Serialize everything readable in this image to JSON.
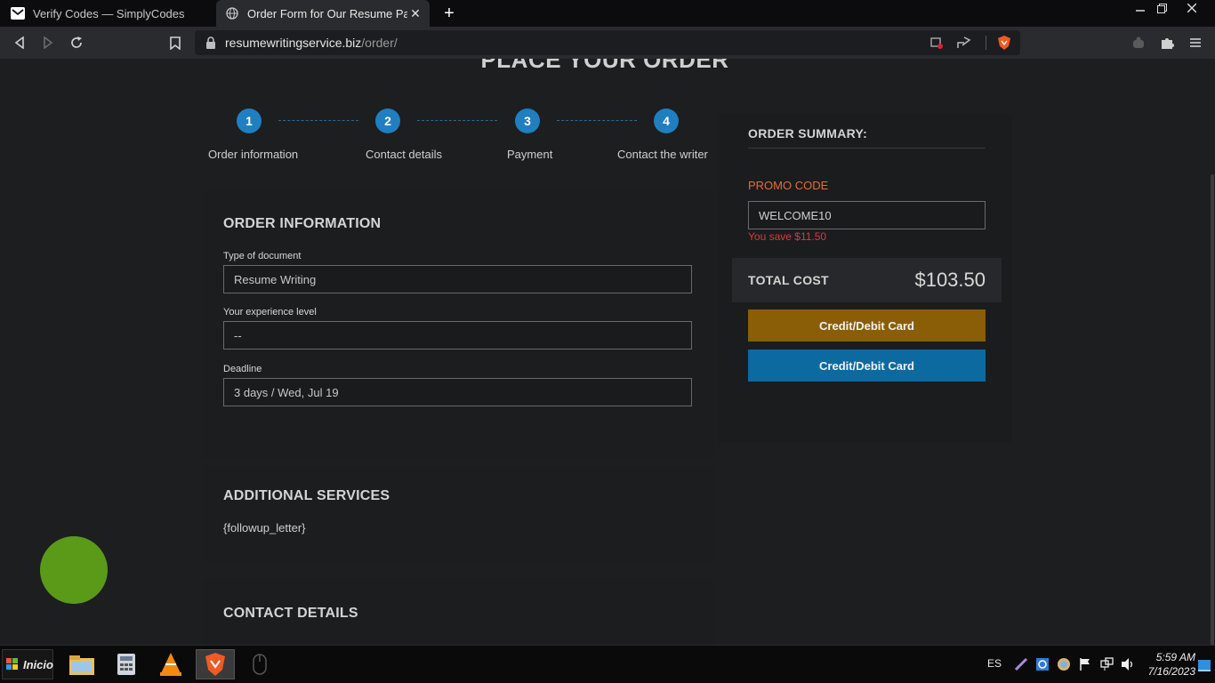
{
  "browser": {
    "tabs": [
      {
        "title": "Verify Codes — SimplyCodes",
        "favicon": "mail-icon"
      },
      {
        "title": "Order Form for Our Resume Packa",
        "favicon": "globe-icon"
      }
    ],
    "new_tab": "+",
    "url_domain": "resumewritingservice.biz",
    "url_path": "/order/"
  },
  "page": {
    "title": "PLACE YOUR ORDER",
    "steps": [
      {
        "number": "1",
        "label": "Order information"
      },
      {
        "number": "2",
        "label": "Contact details"
      },
      {
        "number": "3",
        "label": "Payment"
      },
      {
        "number": "4",
        "label": "Contact the writer"
      }
    ],
    "order_info": {
      "heading": "ORDER INFORMATION",
      "doc_type_label": "Type of document",
      "doc_type_value": "Resume Writing",
      "experience_label": "Your experience level",
      "experience_value": "--",
      "deadline_label": "Deadline",
      "deadline_value": "3 days / Wed, Jul 19"
    },
    "additional": {
      "heading": "ADDITIONAL SERVICES",
      "placeholder_text": "{followup_letter}"
    },
    "contact": {
      "heading": "CONTACT DETAILS"
    },
    "summary": {
      "heading": "ORDER SUMMARY:",
      "promo_label": "PROMO CODE",
      "promo_value": "WELCOME10",
      "promo_saving": "You save $11.50",
      "total_label": "TOTAL COST",
      "total_value": "$103.50",
      "pay_button_1": "Credit/Debit Card",
      "pay_button_2": "Credit/Debit Card"
    }
  },
  "colors": {
    "step_blue": "#1f7fc0",
    "promo_orange": "#e86b3a",
    "saving_red": "#d83b3b",
    "pay_gold": "#8a5e06",
    "pay_blue": "#0d6aa0",
    "chat_green": "#5b9a19"
  },
  "taskbar": {
    "start_label": "Inicio",
    "language": "ES",
    "time": "5:59 AM",
    "date": "7/16/2023"
  }
}
